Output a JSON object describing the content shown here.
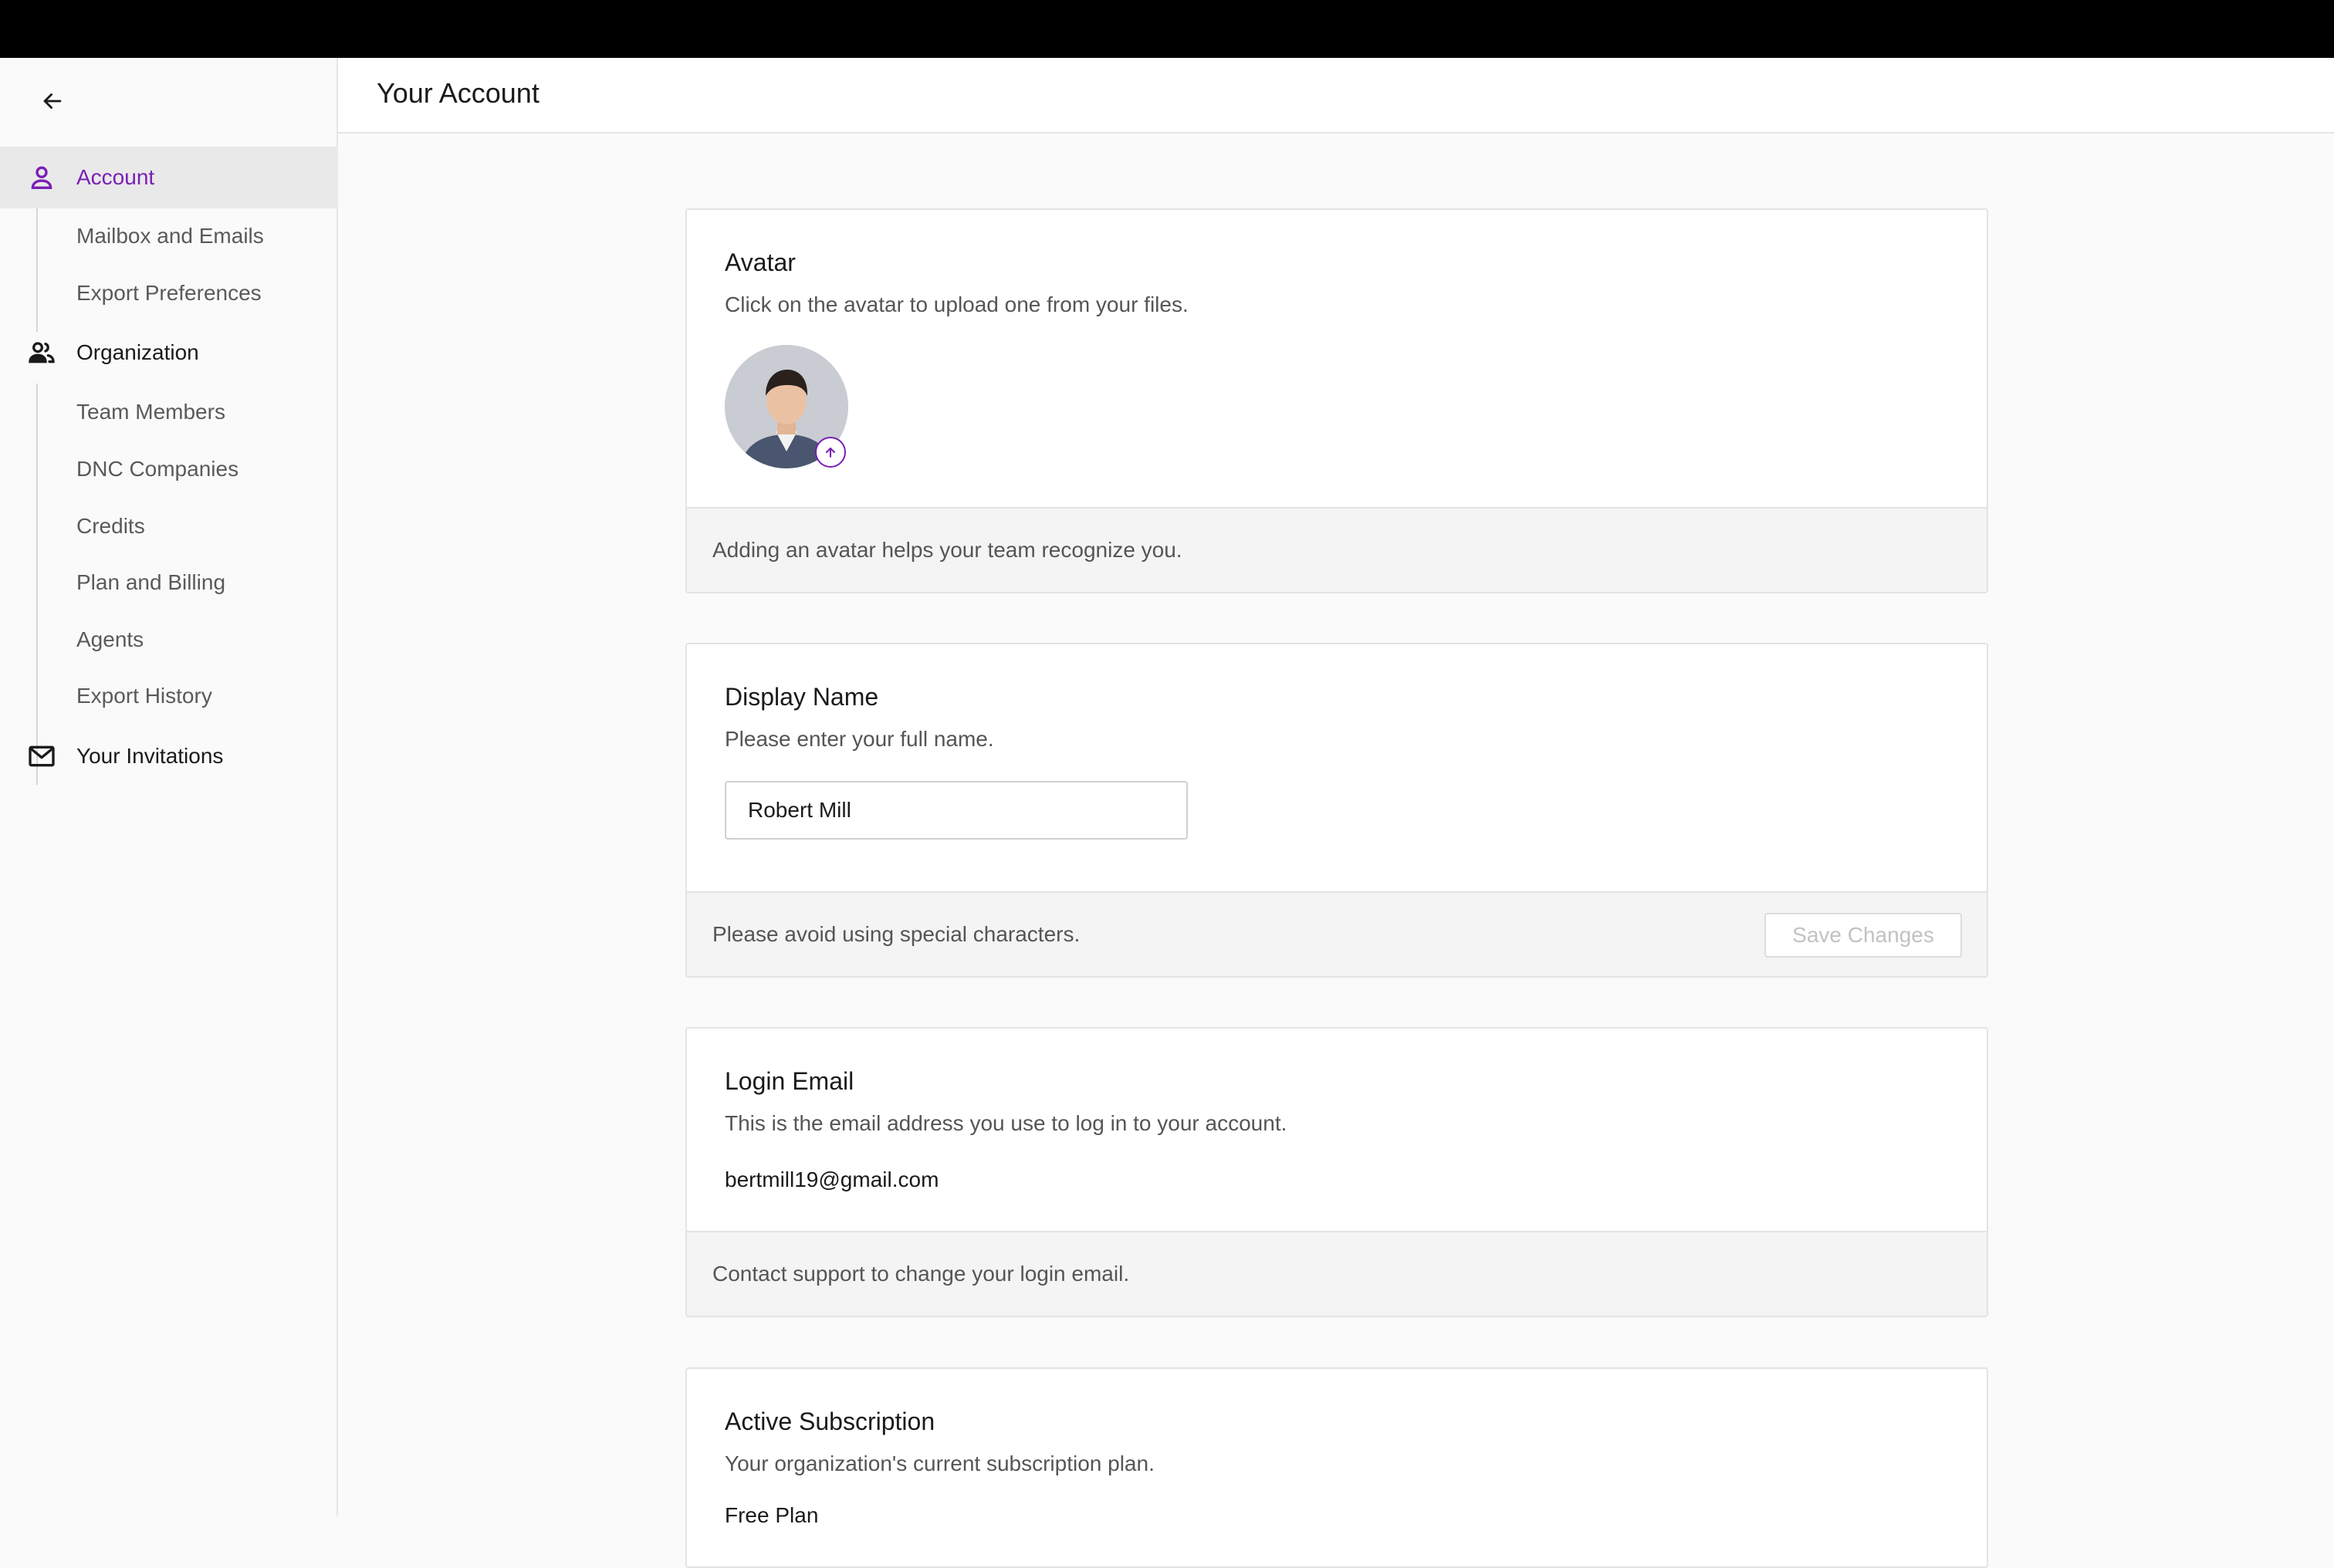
{
  "header": {
    "title": "Your Account"
  },
  "sidebar": {
    "items": [
      {
        "label": "Account"
      },
      {
        "label": "Mailbox and Emails"
      },
      {
        "label": "Export Preferences"
      },
      {
        "label": "Organization"
      },
      {
        "label": "Team Members"
      },
      {
        "label": "DNC Companies"
      },
      {
        "label": "Credits"
      },
      {
        "label": "Plan and Billing"
      },
      {
        "label": "Agents"
      },
      {
        "label": "Export History"
      },
      {
        "label": "Your Invitations"
      }
    ],
    "active": "Account"
  },
  "avatar_card": {
    "title": "Avatar",
    "description": "Click on the avatar to upload one from your files.",
    "footer": "Adding an avatar helps your team recognize you."
  },
  "name_card": {
    "title": "Display Name",
    "description": "Please enter your full name.",
    "value": "Robert Mill",
    "footer": "Please avoid using special characters.",
    "save_label": "Save Changes"
  },
  "email_card": {
    "title": "Login Email",
    "description": "This is the email address you use to log in to your account.",
    "email": "bertmill19@gmail.com",
    "footer": "Contact support to change your login email."
  },
  "subscription_card": {
    "title": "Active Subscription",
    "description": "Your organization's current subscription plan.",
    "plan": "Free Plan"
  },
  "colors": {
    "accent": "#7a1fb5",
    "topbar": "#000000"
  }
}
